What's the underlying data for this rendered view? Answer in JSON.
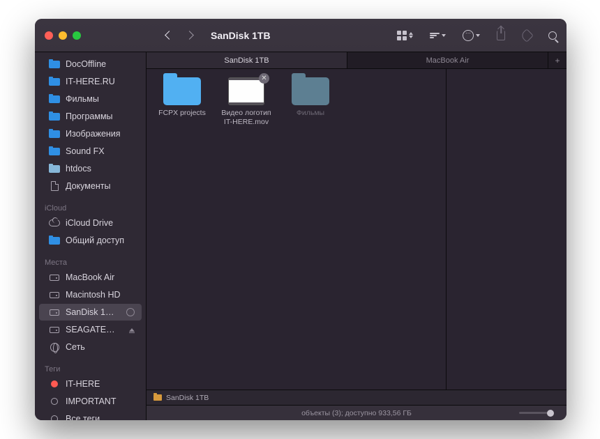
{
  "window": {
    "title": "SanDisk 1TB"
  },
  "sidebar": {
    "favorites": [
      {
        "label": "DocOffline"
      },
      {
        "label": "IT-HERE.RU"
      },
      {
        "label": "Фильмы"
      },
      {
        "label": "Программы"
      },
      {
        "label": "Изображения"
      },
      {
        "label": "Sound FX"
      },
      {
        "label": "htdocs"
      },
      {
        "label": "Документы"
      }
    ],
    "icloud_head": "iCloud",
    "icloud": [
      {
        "label": "iCloud Drive"
      },
      {
        "label": "Общий доступ"
      }
    ],
    "locations_head": "Места",
    "locations": [
      {
        "label": "MacBook Air"
      },
      {
        "label": "Macintosh HD"
      },
      {
        "label": "SanDisk 1…"
      },
      {
        "label": "SEAGATE…"
      },
      {
        "label": "Сеть"
      }
    ],
    "tags_head": "Теги",
    "tags": [
      {
        "label": "IT-HERE"
      },
      {
        "label": "IMPORTANT"
      },
      {
        "label": "Все теги…"
      }
    ]
  },
  "tabs": [
    {
      "label": "SanDisk 1TB"
    },
    {
      "label": "MacBook Air"
    }
  ],
  "files": [
    {
      "label": "FCPX projects"
    },
    {
      "label": "Видео логотип IT-HERE.mov"
    },
    {
      "label": "Фильмы"
    }
  ],
  "pathbar": {
    "label": "SanDisk 1TB"
  },
  "status": {
    "text": "объекты (3); доступно 933,56 ГБ"
  }
}
